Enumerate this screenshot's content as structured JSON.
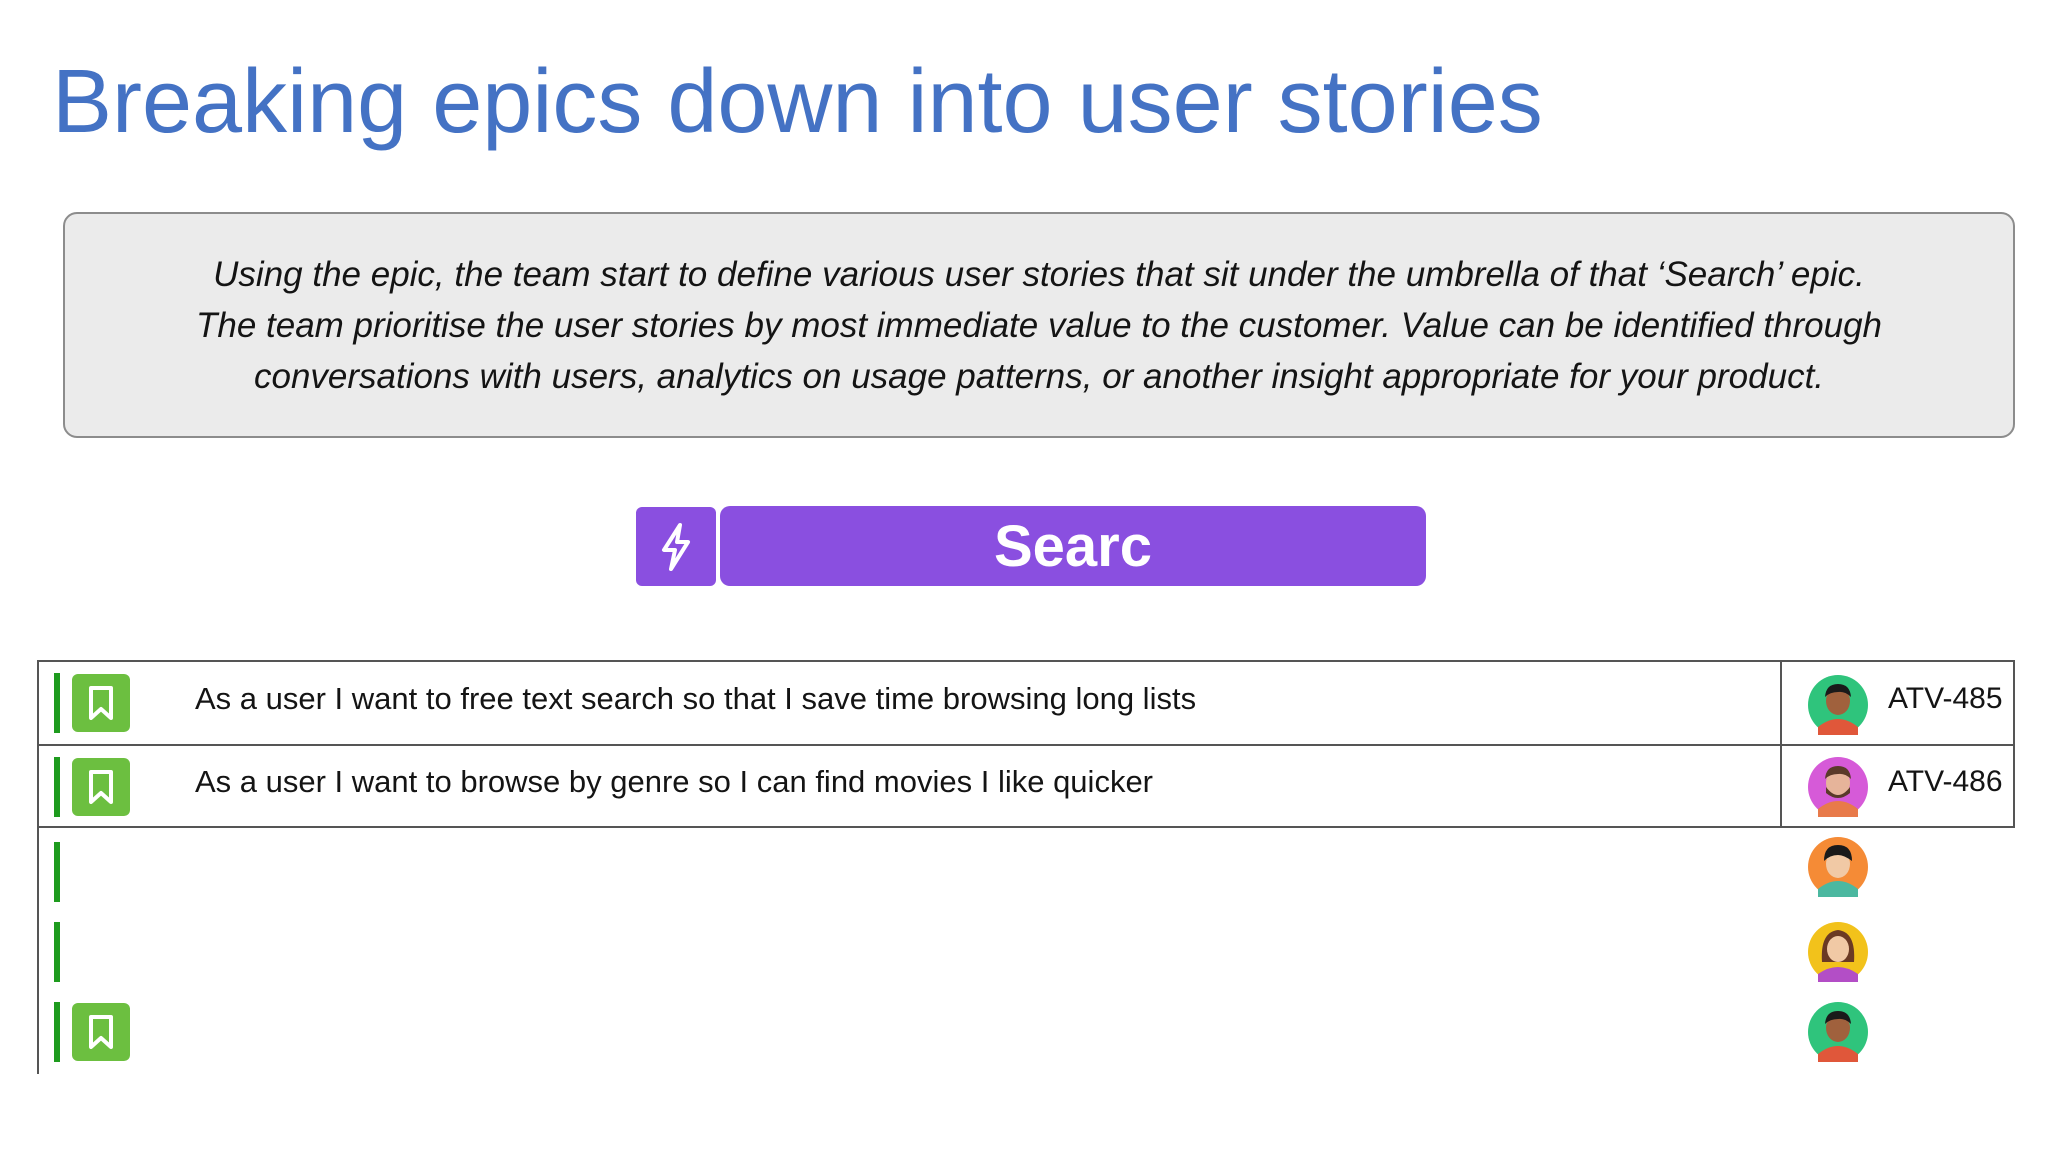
{
  "slide": {
    "title": "Breaking epics down into user stories",
    "description": [
      "Using the epic, the team start to define various user stories that sit under the umbrella of that ‘Search’ epic.",
      "The  team prioritise the user stories by most immediate value to the customer. Value can be identified through",
      "conversations with users, analytics on usage patterns, or another insight appropriate for your product."
    ]
  },
  "epic": {
    "icon": "lightning-icon",
    "label": "Searc",
    "color": "#8a4fe0"
  },
  "colors": {
    "title": "#4472c4",
    "accent": "#1e9b1e",
    "story_icon": "#6cbf40"
  },
  "stories": [
    {
      "text": "As a user I want to free text search so that I save time browsing long lists",
      "ticket": "ATV-485",
      "avatar": "avatar-man-green-icon",
      "has_icon": true
    },
    {
      "text": "As a user I want to browse by genre so I can find movies I like quicker",
      "ticket": "ATV-486",
      "avatar": "avatar-man-beard-pink-icon",
      "has_icon": true
    },
    {
      "text": "",
      "ticket": "",
      "avatar": "avatar-woman-orange-icon",
      "has_icon": false
    },
    {
      "text": "",
      "ticket": "",
      "avatar": "avatar-woman-yellow-icon",
      "has_icon": false
    },
    {
      "text": "",
      "ticket": "",
      "avatar": "avatar-man-green-icon",
      "has_icon": true
    }
  ]
}
